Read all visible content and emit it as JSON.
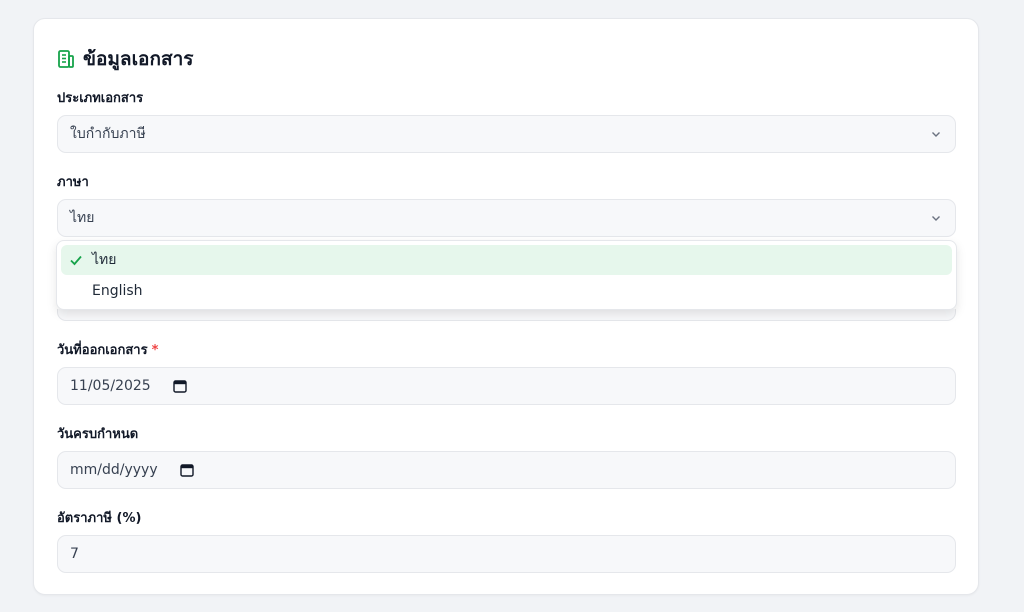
{
  "section": {
    "title": "ข้อมูลเอกสาร",
    "icon": "building-icon"
  },
  "fields": {
    "doc_type": {
      "label": "ประเภทเอกสาร",
      "value": "ใบกำกับภาษี"
    },
    "language": {
      "label": "ภาษา",
      "value": "ไทย",
      "options": [
        {
          "label": "ไทย",
          "selected": true
        },
        {
          "label": "English",
          "selected": false
        }
      ]
    },
    "issue_date": {
      "label": "วันที่ออกเอกสาร",
      "required_mark": "*",
      "value": "11/05/2025"
    },
    "due_date": {
      "label": "วันครบกำหนด",
      "placeholder": "mm/dd/yyyy"
    },
    "tax_rate": {
      "label": "อัตราภาษี (%)",
      "value": "7"
    }
  },
  "colors": {
    "accent": "#16a34a",
    "selected_bg": "#e6f7ec",
    "required": "#ef4444"
  }
}
